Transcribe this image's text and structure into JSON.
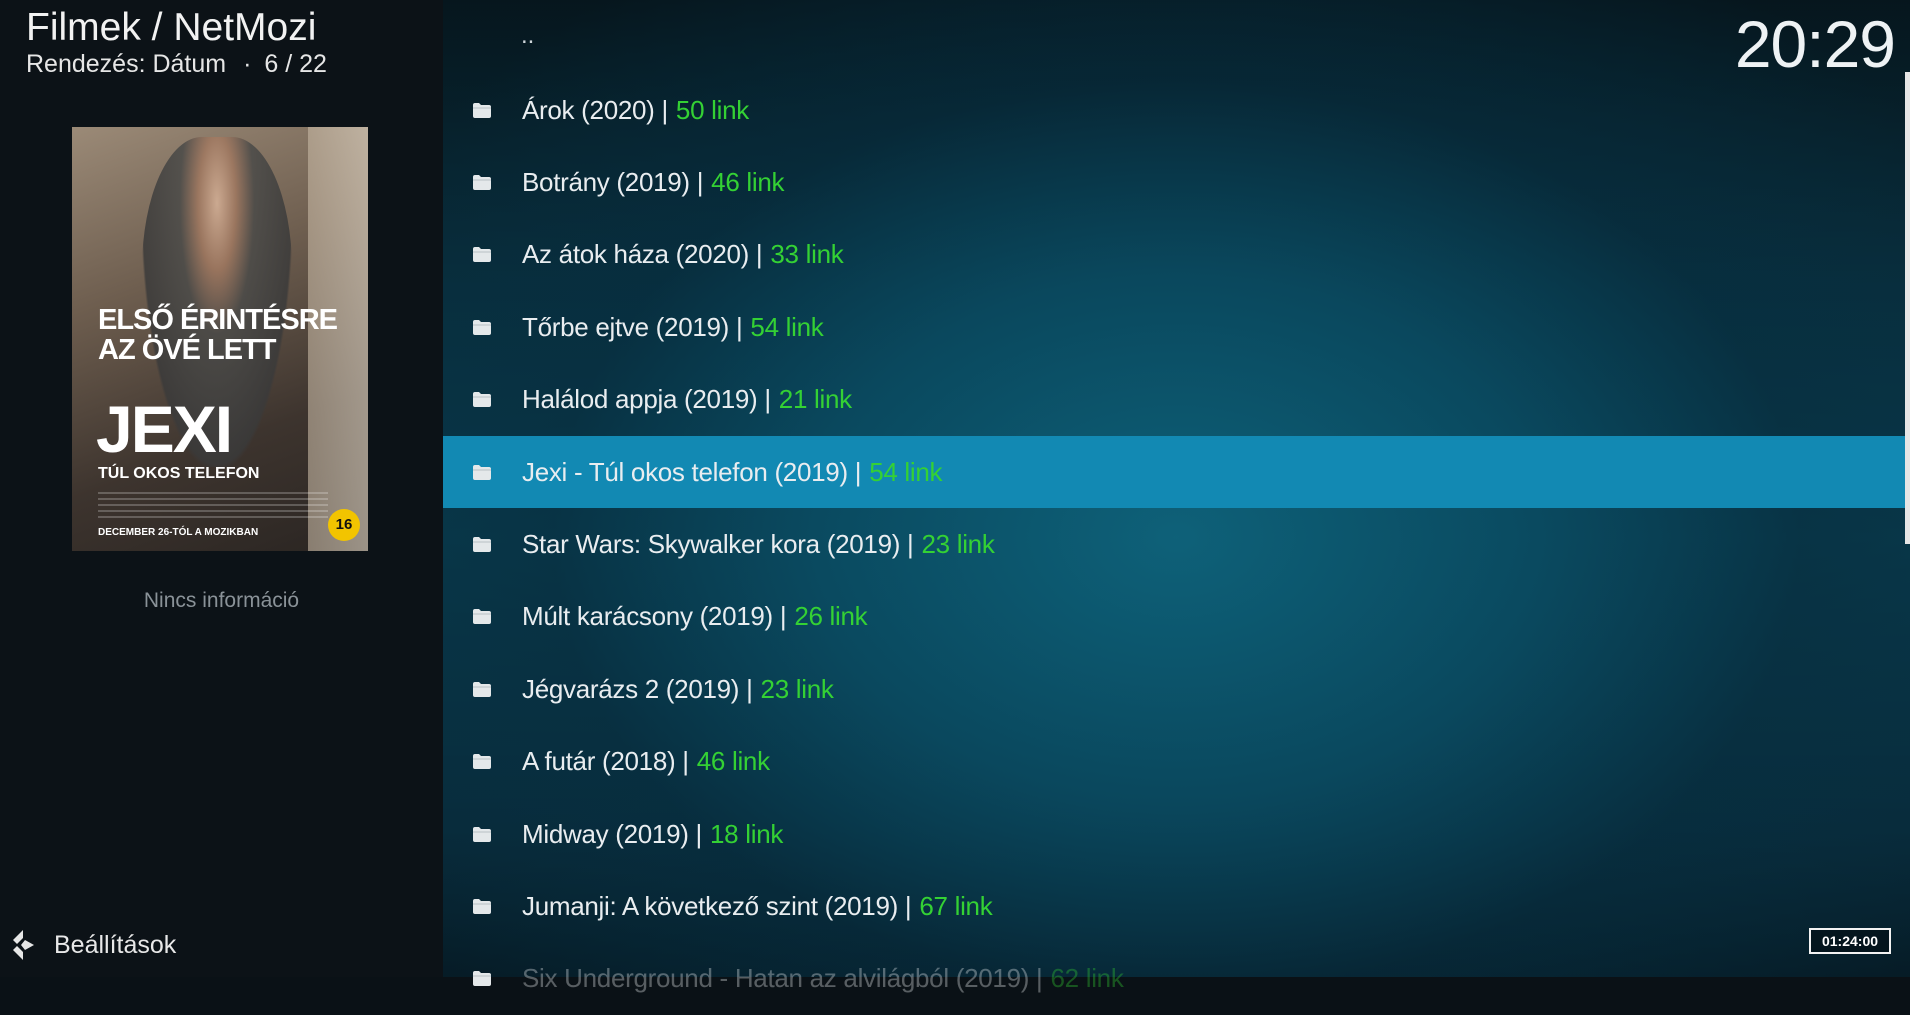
{
  "header": {
    "title": "Filmek / NetMozi",
    "sort_label": "Rendezés: Dátum",
    "separator": "·",
    "position": "6 / 22",
    "clock": "20:29"
  },
  "poster": {
    "tagline_1": "ELSŐ ÉRINTÉSRE",
    "tagline_2": "AZ ÖVÉ LETT",
    "title": "JEXI",
    "subtitle": "TÚL OKOS TELEFON",
    "date_line": "DECEMBER 26-TÓL A MOZIKBAN",
    "rating": "16"
  },
  "sidebar": {
    "no_info": "Nincs információ",
    "settings_label": "Beállítások",
    "settings_icon": "kodi-icon"
  },
  "list": {
    "up_label": "..",
    "items": [
      {
        "name": "Árok (2020) |",
        "links": "50 link"
      },
      {
        "name": "Botrány (2019) |",
        "links": "46 link"
      },
      {
        "name": "Az átok háza (2020) |",
        "links": "33 link"
      },
      {
        "name": "Tőrbe ejtve (2019) |",
        "links": "54 link"
      },
      {
        "name": "Halálod appja (2019) |",
        "links": "21 link"
      },
      {
        "name": "Jexi - Túl okos telefon (2019) |",
        "links": "54 link",
        "selected": true
      },
      {
        "name": "Star Wars: Skywalker kora (2019) |",
        "links": "23 link"
      },
      {
        "name": "Múlt karácsony (2019) |",
        "links": "26 link"
      },
      {
        "name": "Jégvarázs 2 (2019) |",
        "links": "23 link"
      },
      {
        "name": "A futár (2018) |",
        "links": "46 link"
      },
      {
        "name": "Midway (2019) |",
        "links": "18 link"
      },
      {
        "name": "Jumanji: A következő szint (2019) |",
        "links": "67 link"
      },
      {
        "name": "Six Underground - Hatan az alvilágból (2019) |",
        "links": "62 link"
      }
    ]
  },
  "footer": {
    "duration": "01:24:00"
  },
  "colors": {
    "accent_selected": "#1289b3",
    "link_count_green": "#34d134"
  }
}
